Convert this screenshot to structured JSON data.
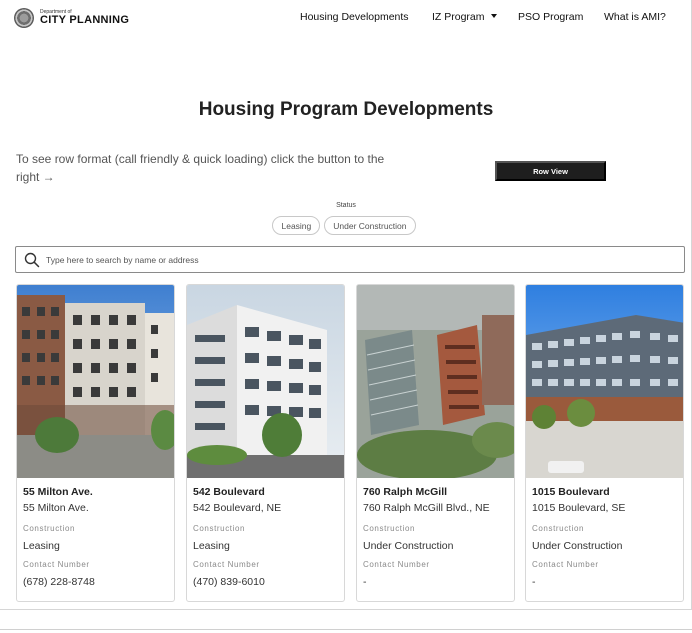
{
  "header": {
    "logo_small": "Department of",
    "logo_big": "CITY PLANNING",
    "nav": [
      {
        "label": "Housing Developments"
      },
      {
        "label": "IZ Program",
        "dropdown": true
      },
      {
        "label": "PSO Program"
      },
      {
        "label": "What is AMI?"
      }
    ]
  },
  "page": {
    "title": "Housing Program Developments",
    "intro": "To see row format (call friendly & quick loading) click the button to the right →",
    "row_view_button": "Row View",
    "status_label": "Status",
    "status_filters": [
      "Leasing",
      "Under Construction"
    ]
  },
  "search": {
    "placeholder": "Type here to search by name or address",
    "value": ""
  },
  "cards": [
    {
      "name": "55 Milton Ave.",
      "address": "55 Milton Ave.",
      "construction_label": "Construction",
      "construction": "Leasing",
      "contact_label": "Contact Number",
      "contact": "(678) 228-8748"
    },
    {
      "name": "542 Boulevard",
      "address": "542 Boulevard, NE",
      "construction_label": "Construction",
      "construction": "Leasing",
      "contact_label": "Contact Number",
      "contact": "(470) 839-6010"
    },
    {
      "name": "760 Ralph McGill",
      "address": "760 Ralph McGill Blvd., NE",
      "construction_label": "Construction",
      "construction": "Under Construction",
      "contact_label": "Contact Number",
      "contact": "-"
    },
    {
      "name": "1015 Boulevard",
      "address": "1015 Boulevard, SE",
      "construction_label": "Construction",
      "construction": "Under Construction",
      "contact_label": "Contact Number",
      "contact": "-"
    }
  ],
  "colors": {
    "button_bg": "#1e1e1e",
    "text": "#222222",
    "muted_label": "#8a8a8a"
  }
}
